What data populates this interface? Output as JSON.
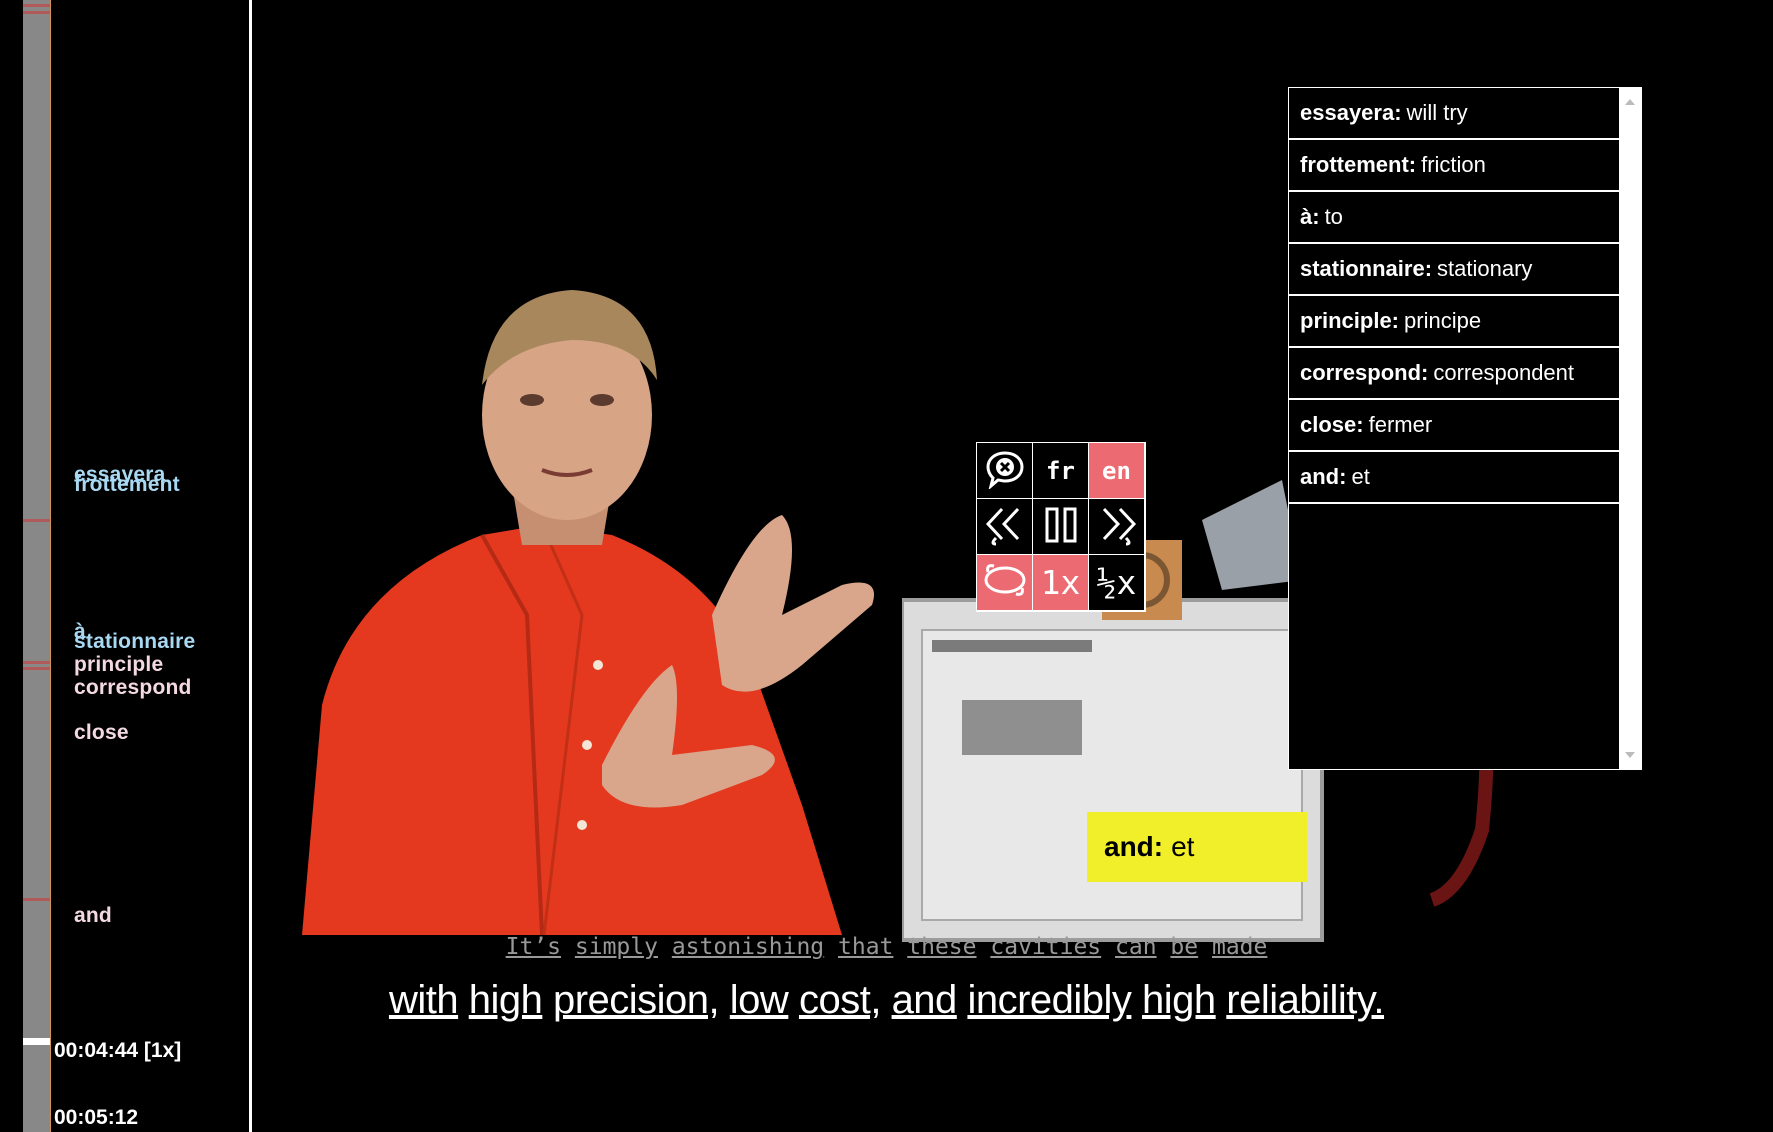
{
  "sidebar": {
    "words": [
      {
        "text": "essayera",
        "color": "#a9d8f2"
      },
      {
        "text": "frottement",
        "color": "#a9d8f2"
      },
      {
        "text": "à",
        "color": "#a9d8f2"
      },
      {
        "text": "stationnaire",
        "color": "#a9d8f2"
      },
      {
        "text": "principle",
        "color": "#f4d9e3"
      },
      {
        "text": "correspond",
        "color": "#f4d9e3"
      },
      {
        "text": "close",
        "color": "#f4d9e3"
      },
      {
        "text": "and",
        "color": "#f4d9e3"
      }
    ],
    "current_time": "00:04:44 [1x]",
    "next_time": "00:05:12"
  },
  "controls": {
    "close_icon": "close-chat-icon",
    "lang_fr": "fr",
    "lang_en": "en",
    "rewind_icon": "rewind-icon",
    "pause_icon": "pause-icon",
    "forward_icon": "fast-forward-icon",
    "loop_icon": "loop-icon",
    "speed_normal": "1x",
    "speed_half": "½x",
    "active_color": "#ec6b72"
  },
  "vocab": {
    "items": [
      {
        "term": "essayera:",
        "translation": "will try"
      },
      {
        "term": "frottement:",
        "translation": "friction"
      },
      {
        "term": "à:",
        "translation": "to"
      },
      {
        "term": "stationnaire:",
        "translation": "stationary"
      },
      {
        "term": "principle:",
        "translation": "principe"
      },
      {
        "term": "correspond:",
        "translation": "correspondent"
      },
      {
        "term": "close:",
        "translation": "fermer"
      },
      {
        "term": "and:",
        "translation": "et"
      }
    ]
  },
  "tooltip": {
    "term": "and:",
    "translation": "et",
    "color": "#f0ef2a"
  },
  "subtitles": {
    "french_words": [
      "It’s",
      "simply",
      "astonishing",
      "that",
      "these",
      "cavities",
      "can",
      "be",
      "made"
    ],
    "english_words": [
      "with",
      "high",
      "precision,",
      "low",
      "cost,",
      "and",
      "incredibly",
      "high",
      "reliability."
    ]
  }
}
